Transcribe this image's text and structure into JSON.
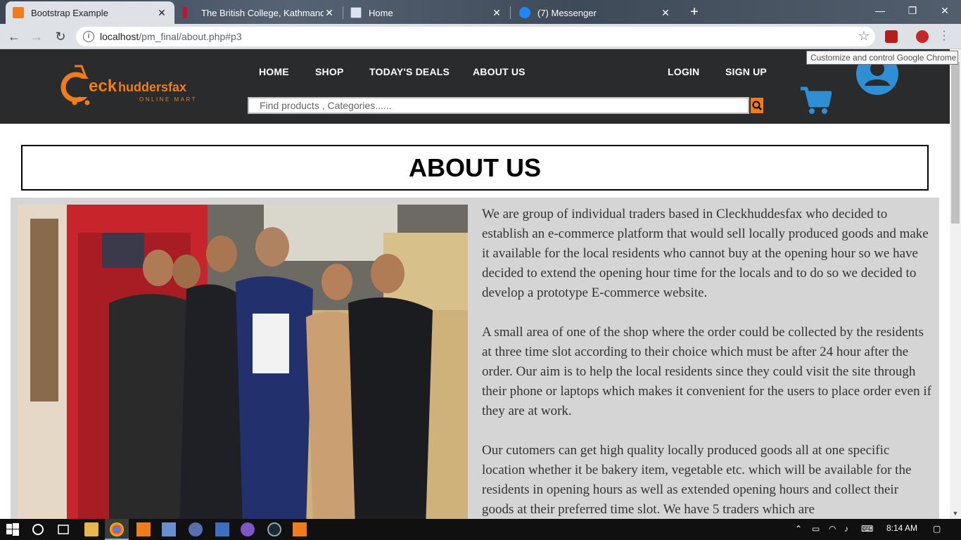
{
  "browser": {
    "tabs": [
      {
        "title": "Bootstrap Example",
        "active": true
      },
      {
        "title": "The British College, Kathmandu :",
        "active": false
      },
      {
        "title": "Home",
        "active": false
      },
      {
        "title": "(7) Messenger",
        "active": false
      }
    ],
    "url_host": "localhost",
    "url_path": "/pm_final/about.php#p3",
    "tooltip": "Customize and control Google Chrome"
  },
  "site": {
    "logo_text": "Cleckhuddersfax",
    "logo_sub": "ONLINE MART",
    "nav": [
      "HOME",
      "SHOP",
      "TODAY'S DEALS",
      "ABOUT US"
    ],
    "auth": [
      "LOGIN",
      "SIGN UP"
    ],
    "search_placeholder": "Find products , Categories......",
    "accent_color": "#f07d1a",
    "icon_color": "#2f8fd5"
  },
  "about": {
    "title": "ABOUT US",
    "paragraphs": [
      "We are group of individual traders based in Cleckhuddesfax who decided to establish an e-commerce platform that would sell locally produced goods and make it available for the local residents who cannot buy at the opening hour so we have decided to extend the opening hour time for the locals and to do so we decided to develop a prototype E-commerce website.",
      "A small area of one of the shop where the order could be collected by the residents at three time slot according to their choice which must be after 24 hour after the order. Our aim is to help the local residents since they could visit the site through their phone or laptops which makes it convenient for the users to place order even if they are at work.",
      "Our cutomers can get high quality locally produced goods all at one specific location whether it be bakery item, vegetable etc. which will be available for the residents in opening hours as well as extended opening hours and collect their goods at their preferred time slot. We have 5 traders which are"
    ]
  },
  "taskbar": {
    "time": "8:14 AM"
  }
}
